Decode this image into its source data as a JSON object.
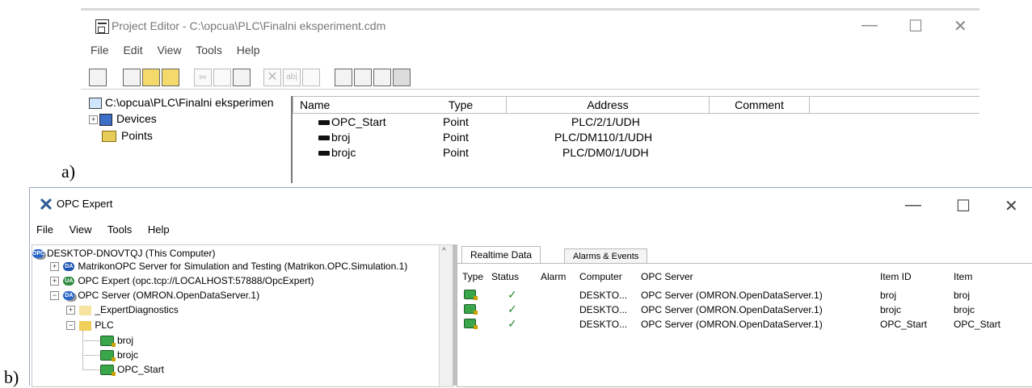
{
  "panel_labels": {
    "a": "a)",
    "b": "b)"
  },
  "project_editor": {
    "title": "Project Editor - C:\\opcua\\PLC\\Finalni eksperiment.cdm",
    "window_buttons": {
      "minimize": "—",
      "maximize": "☐",
      "close": "✕"
    },
    "menu": [
      "File",
      "Edit",
      "View",
      "Tools",
      "Help"
    ],
    "toolbar_glyphs": {
      "cut": "✂",
      "delete": "✕",
      "rename": "ab|"
    },
    "tree": {
      "root": "C:\\opcua\\PLC\\Finalni eksperimen",
      "expander": "+",
      "items": [
        "Devices",
        "Points"
      ]
    },
    "columns": [
      "Name",
      "Type",
      "Address",
      "Comment"
    ],
    "rows": [
      {
        "name": "OPC_Start",
        "type": "Point",
        "address": "PLC/2/1/UDH"
      },
      {
        "name": "broj",
        "type": "Point",
        "address": "PLC/DM110/1/UDH"
      },
      {
        "name": "brojc",
        "type": "Point",
        "address": "PLC/DM0/1/UDH"
      }
    ]
  },
  "opc_expert": {
    "title": "OPC Expert",
    "window_buttons": {
      "minimize": "—",
      "maximize": "☐",
      "close": "✕"
    },
    "menu": [
      "File",
      "View",
      "Tools",
      "Help"
    ],
    "tree": {
      "root": "DESKTOP-DNOVTQJ (This Computer)",
      "nodes": [
        "MatrikonOPC Server for Simulation and Testing (Matrikon.OPC.Simulation.1)",
        "OPC Expert (opc.tcp://LOCALHOST:57888/OpcExpert)",
        "OPC Server (OMRON.OpenDataServer.1)",
        "_ExpertDiagnostics",
        "PLC",
        "broj",
        "brojc",
        "OPC_Start"
      ],
      "expanders": {
        "collapsed": "+",
        "expanded": "−"
      },
      "scroll_arrow": "^",
      "icon_labels": {
        "da": "DA",
        "ua": "UA",
        "opc": "OPC"
      }
    },
    "tabs": [
      "Realtime Data",
      "Alarms & Events"
    ],
    "columns": [
      "Type",
      "Status",
      "Alarm",
      "Computer",
      "OPC Server",
      "Item ID",
      "Item"
    ],
    "rows": [
      {
        "status": "✓",
        "alarm": "",
        "computer": "DESKTO...",
        "server": "OPC Server (OMRON.OpenDataServer.1)",
        "item_id": "broj",
        "item": "broj"
      },
      {
        "status": "✓",
        "alarm": "",
        "computer": "DESKTO...",
        "server": "OPC Server (OMRON.OpenDataServer.1)",
        "item_id": "brojc",
        "item": "brojc"
      },
      {
        "status": "✓",
        "alarm": "",
        "computer": "DESKTO...",
        "server": "OPC Server (OMRON.OpenDataServer.1)",
        "item_id": "OPC_Start",
        "item": "OPC_Start"
      }
    ]
  }
}
